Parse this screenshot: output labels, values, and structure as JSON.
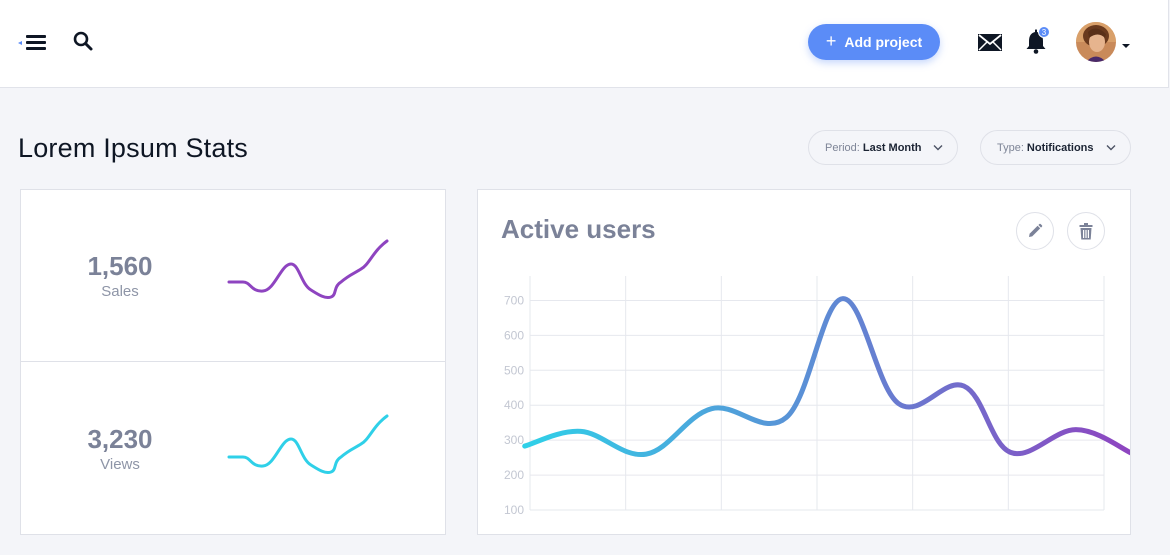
{
  "topbar": {
    "menu_icon": "hamburger-menu-icon",
    "search_icon": "search-icon",
    "add_project_label": "Add project",
    "mail_icon": "mail-icon",
    "bell_icon": "bell-icon",
    "notification_count": "3",
    "avatar_icon": "user-avatar",
    "accent_color": "#5b8cf7"
  },
  "page": {
    "title": "Lorem Ipsum Stats"
  },
  "filters": {
    "period": {
      "label": "Period:",
      "value": "Last Month"
    },
    "type": {
      "label": "Type:",
      "value": "Notifications"
    }
  },
  "stats": {
    "sales": {
      "value": "1,560",
      "label": "Sales",
      "color": "#8e44c0"
    },
    "views": {
      "value": "3,230",
      "label": "Views",
      "color": "#2fd0e8"
    }
  },
  "active_users": {
    "title": "Active users",
    "edit_icon": "pencil-icon",
    "delete_icon": "trash-icon"
  },
  "chart_data": {
    "type": "line",
    "title": "Active users",
    "xlabel": "",
    "ylabel": "",
    "y_ticks": [
      "100",
      "200",
      "300",
      "400",
      "500",
      "600",
      "700"
    ],
    "ylim": [
      100,
      770
    ],
    "grid": true,
    "line_gradient": [
      "#2fd0e8",
      "#8e44c0"
    ],
    "points": [
      [
        0,
        283
      ],
      [
        0.6,
        325
      ],
      [
        1.3,
        260
      ],
      [
        2,
        390
      ],
      [
        2.8,
        365
      ],
      [
        3.4,
        705
      ],
      [
        4.0,
        405
      ],
      [
        4.7,
        455
      ],
      [
        5.2,
        265
      ],
      [
        5.9,
        330
      ],
      [
        6.5,
        262
      ]
    ],
    "xlim": [
      -0.5,
      6.5
    ]
  }
}
